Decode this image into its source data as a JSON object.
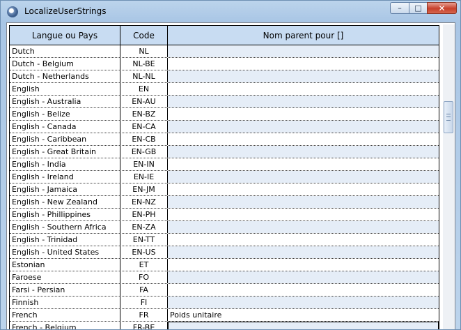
{
  "window": {
    "title": "LocalizeUserStrings",
    "minimize_label": "–",
    "maximize_label": "□",
    "close_label": "✕"
  },
  "grid": {
    "columns": [
      "Langue ou Pays",
      "Code",
      "Nom parent pour []"
    ],
    "rows": [
      [
        "Dutch",
        "NL",
        ""
      ],
      [
        "Dutch - Belgium",
        "NL-BE",
        ""
      ],
      [
        "Dutch - Netherlands",
        "NL-NL",
        ""
      ],
      [
        "English",
        "EN",
        ""
      ],
      [
        "English - Australia",
        "EN-AU",
        ""
      ],
      [
        "English - Belize",
        "EN-BZ",
        ""
      ],
      [
        "English - Canada",
        "EN-CA",
        ""
      ],
      [
        "English - Caribbean",
        "EN-CB",
        ""
      ],
      [
        "English - Great Britain",
        "EN-GB",
        ""
      ],
      [
        "English - India",
        "EN-IN",
        ""
      ],
      [
        "English - Ireland",
        "EN-IE",
        ""
      ],
      [
        "English - Jamaica",
        "EN-JM",
        ""
      ],
      [
        "English - New Zealand",
        "EN-NZ",
        ""
      ],
      [
        "English - Phillippines",
        "EN-PH",
        ""
      ],
      [
        "English - Southern Africa",
        "EN-ZA",
        ""
      ],
      [
        "English - Trinidad",
        "EN-TT",
        ""
      ],
      [
        "English - United States",
        "EN-US",
        ""
      ],
      [
        "Estonian",
        "ET",
        ""
      ],
      [
        "Faroese",
        "FO",
        ""
      ],
      [
        "Farsi - Persian",
        "FA",
        ""
      ],
      [
        "Finnish",
        "FI",
        ""
      ],
      [
        "French",
        "FR",
        "Poids unitaire"
      ],
      [
        "French - Belgium",
        "FR-BE",
        ""
      ]
    ],
    "selected_row": 22
  },
  "scrollbar": {
    "position_fraction": 0.28
  }
}
